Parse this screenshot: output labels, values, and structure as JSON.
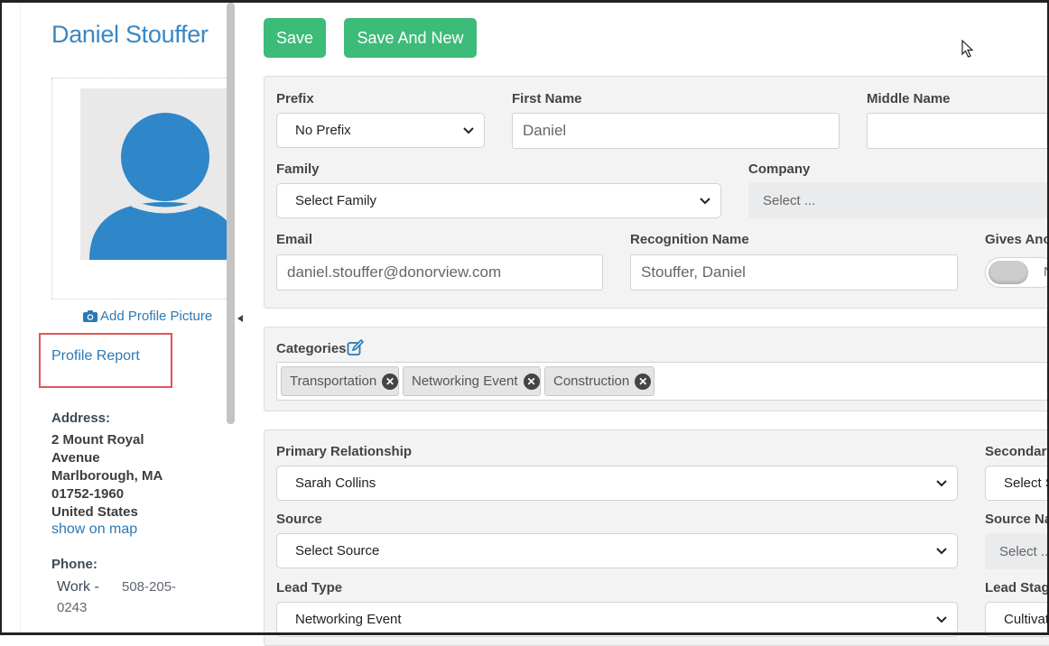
{
  "sidebar": {
    "name": "Daniel Stouffer",
    "add_picture_label": "Add Profile Picture",
    "profile_report_label": "Profile Report",
    "address_label": "Address:",
    "address_lines": [
      "2 Mount Royal",
      "Avenue",
      "Marlborough, MA",
      "01752-1960",
      "United States"
    ],
    "show_on_map": "show on map",
    "phone_label": "Phone:",
    "phone_type": "Work -",
    "phone_part1": "508-205-",
    "phone_part2": "0243"
  },
  "toolbar": {
    "save_label": "Save",
    "save_and_new_label": "Save And New"
  },
  "form": {
    "prefix_label": "Prefix",
    "prefix_value": "No Prefix",
    "first_name_label": "First Name",
    "first_name_value": "Daniel",
    "middle_name_label": "Middle Name",
    "middle_name_value": "",
    "family_label": "Family",
    "family_value": "Select Family",
    "company_label": "Company",
    "company_value": "Select ...",
    "email_label": "Email",
    "email_value": "daniel.stouffer@donorview.com",
    "recognition_label": "Recognition Name",
    "recognition_value": "Stouffer, Daniel",
    "gives_label": "Gives Ano",
    "gives_toggle_text": "N",
    "categories_label": "Categories",
    "categories": [
      "Transportation",
      "Networking Event",
      "Construction"
    ],
    "primary_rel_label": "Primary Relationship",
    "primary_rel_value": "Sarah Collins",
    "secondary_label": "Secondary",
    "secondary_value": "Select S",
    "source_label": "Source",
    "source_value": "Select Source",
    "source_name_label": "Source Na",
    "source_name_value": "Select ...",
    "lead_type_label": "Lead Type",
    "lead_type_value": "Networking Event",
    "lead_stage_label": "Lead Stage",
    "lead_stage_value": "Cultivat"
  },
  "colors": {
    "accent_blue": "#3a87c3",
    "link_blue": "#2b79b6",
    "button_green": "#3dbb78",
    "highlight_red": "#e0555a",
    "avatar_blue": "#2f86c8"
  }
}
